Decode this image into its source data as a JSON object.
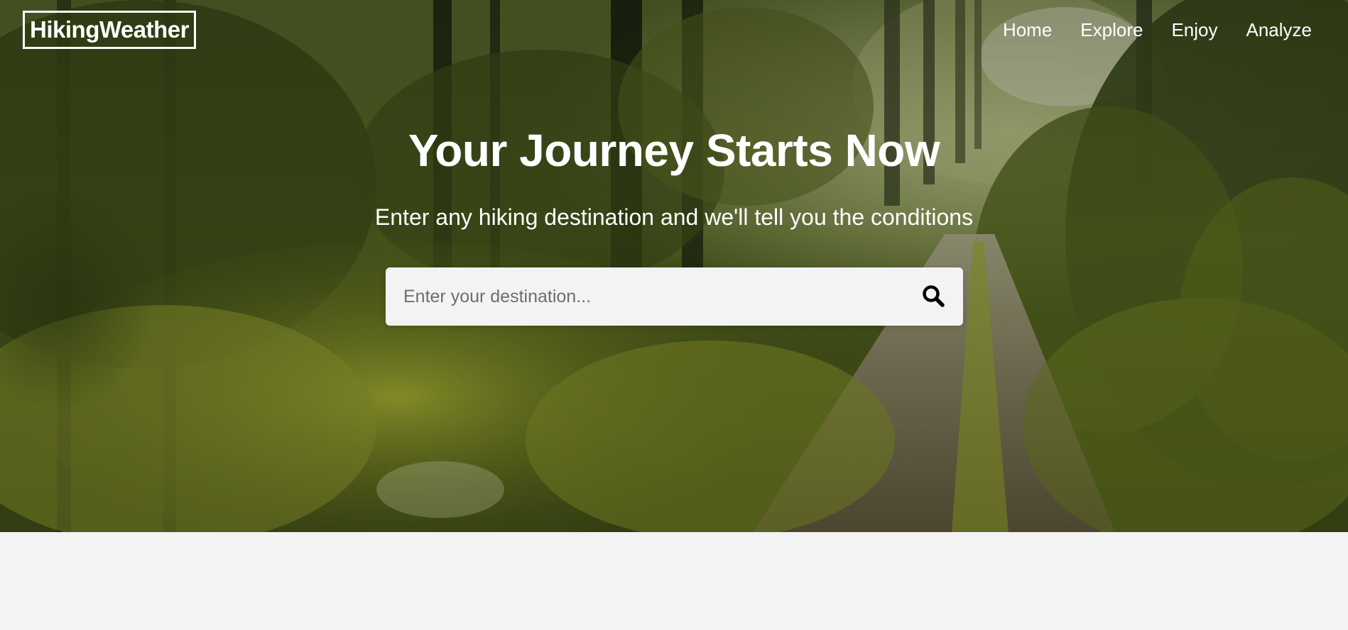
{
  "brand": {
    "logo_text": "HikingWeather"
  },
  "nav": {
    "items": [
      {
        "label": "Home"
      },
      {
        "label": "Explore"
      },
      {
        "label": "Enjoy"
      },
      {
        "label": "Analyze"
      }
    ]
  },
  "hero": {
    "title": "Your Journey Starts Now",
    "subtitle": "Enter any hiking destination and we'll tell you the conditions",
    "background": "forest-path-photo"
  },
  "search": {
    "value": "",
    "placeholder": "Enter your destination...",
    "button_icon": "search-icon"
  },
  "colors": {
    "text_on_hero": "#ffffff",
    "search_bg": "#f3f3f3",
    "page_bg": "#f3f3f3",
    "forest_dark": "#2e3a12",
    "forest_light": "#9aa832"
  }
}
